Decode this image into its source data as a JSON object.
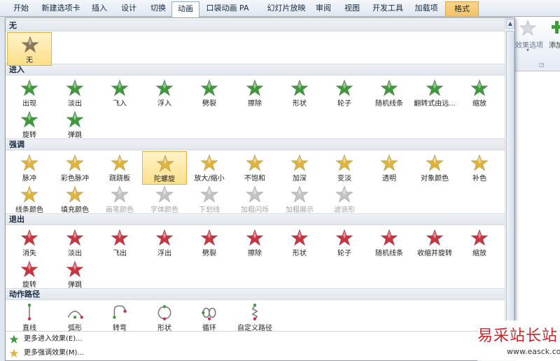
{
  "tabs": [
    {
      "label": "开始"
    },
    {
      "label": "新建选项卡"
    },
    {
      "label": "插入"
    },
    {
      "label": "设计"
    },
    {
      "label": "切换"
    },
    {
      "label": "动画"
    },
    {
      "label": "口袋动画 PA"
    },
    {
      "label": "幻灯片放映"
    },
    {
      "label": "审阅"
    },
    {
      "label": "视图"
    },
    {
      "label": "开发工具"
    },
    {
      "label": "加载项"
    },
    {
      "label": "格式"
    }
  ],
  "ribbon": {
    "effect_options": "效果选项",
    "add": "添加"
  },
  "sections": {
    "none": "无",
    "entrance": "进入",
    "emphasis": "强调",
    "exit": "退出",
    "motion": "动作路径"
  },
  "none_items": [
    {
      "label": "无"
    }
  ],
  "entrance_items": [
    {
      "label": "出现"
    },
    {
      "label": "淡出"
    },
    {
      "label": "飞入"
    },
    {
      "label": "浮入"
    },
    {
      "label": "劈裂"
    },
    {
      "label": "擦除"
    },
    {
      "label": "形状"
    },
    {
      "label": "轮子"
    },
    {
      "label": "随机线条"
    },
    {
      "label": "翻转式由远..."
    },
    {
      "label": "缩放"
    },
    {
      "label": "旋转"
    },
    {
      "label": "弹跳"
    }
  ],
  "emphasis_items": [
    {
      "label": "脉冲"
    },
    {
      "label": "彩色脉冲"
    },
    {
      "label": "跷跷板"
    },
    {
      "label": "陀螺旋"
    },
    {
      "label": "放大/缩小"
    },
    {
      "label": "不饱和"
    },
    {
      "label": "加深"
    },
    {
      "label": "变淡"
    },
    {
      "label": "透明"
    },
    {
      "label": "对象颜色"
    },
    {
      "label": "补色"
    },
    {
      "label": "线条颜色"
    },
    {
      "label": "填充颜色"
    },
    {
      "label": "画笔颜色"
    },
    {
      "label": "字体颜色"
    },
    {
      "label": "下划线"
    },
    {
      "label": "加粗闪烁"
    },
    {
      "label": "加粗展示"
    },
    {
      "label": "波浪形"
    }
  ],
  "exit_items": [
    {
      "label": "消失"
    },
    {
      "label": "淡出"
    },
    {
      "label": "飞出"
    },
    {
      "label": "浮出"
    },
    {
      "label": "劈裂"
    },
    {
      "label": "擦除"
    },
    {
      "label": "形状"
    },
    {
      "label": "轮子"
    },
    {
      "label": "随机线条"
    },
    {
      "label": "收缩并旋转"
    },
    {
      "label": "缩放"
    },
    {
      "label": "旋转"
    },
    {
      "label": "弹跳"
    }
  ],
  "motion_items": [
    {
      "label": "直线"
    },
    {
      "label": "弧形"
    },
    {
      "label": "转弯"
    },
    {
      "label": "形状"
    },
    {
      "label": "循环"
    },
    {
      "label": "自定义路径"
    }
  ],
  "more": {
    "entrance": "更多进入效果(E)...",
    "emphasis": "更多强调效果(M)..."
  },
  "selected_effect": "陀螺旋",
  "watermark": {
    "title": "易采站长站",
    "url": "www.easck.com"
  },
  "colors": {
    "entrance": "#3f9a3c",
    "emphasis": "#e0b43a",
    "exit": "#c9343f",
    "disabled": "#c4c4c4",
    "selection": "#fcdf8a"
  }
}
